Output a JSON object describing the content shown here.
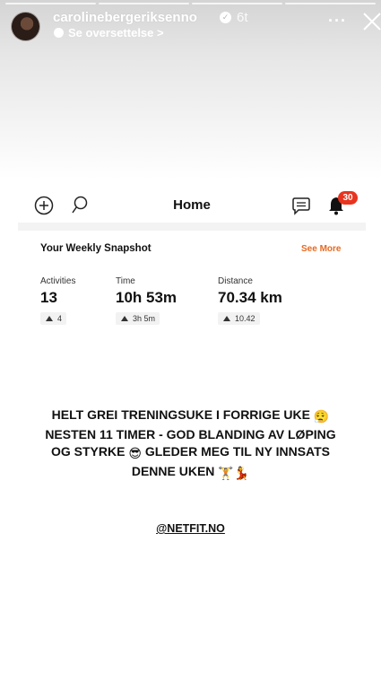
{
  "story": {
    "username": "carolinebergeriksenno",
    "time_ago": "6t",
    "translate_label": "Se oversettelse",
    "translate_chevron": ">",
    "more_label": "···",
    "progress_segments": 4
  },
  "app": {
    "title": "Home",
    "notification_count": "30",
    "snapshot_title": "Your Weekly Snapshot",
    "see_more_label": "See More",
    "stats": [
      {
        "label": "Activities",
        "value": "13",
        "change": "4"
      },
      {
        "label": "Time",
        "value": "10h 53m",
        "change": "3h 5m"
      },
      {
        "label": "Distance",
        "value": "70.34 km",
        "change": "10.42"
      }
    ]
  },
  "caption": {
    "line1": "HELT GREI TRENINGSUKE I FORRIGE UKE",
    "line2": "NESTEN 11 TIMER - GOD BLANDING AV LØPING",
    "line3": "OG STYRKE",
    "line3b": "GLEDER MEG TIL NY INNSATS",
    "line4": "DENNE UKEN",
    "emoji_relieved": "😮‍💨",
    "emoji_sunglasses": "😎",
    "emoji_weightlifter": "🏋️",
    "emoji_dancer": "💃"
  },
  "mention": "@NETFIT.NO",
  "colors": {
    "accent_orange": "#e56a21",
    "badge_red": "#e8341f",
    "text": "#111111"
  }
}
